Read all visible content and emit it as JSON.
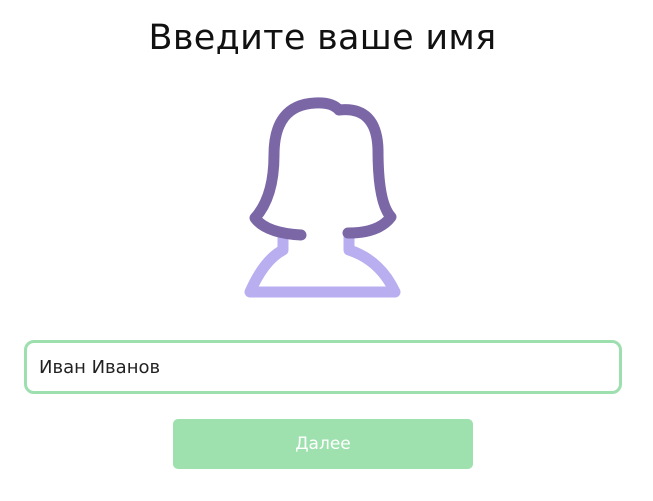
{
  "header": {
    "title": "Введите ваше имя"
  },
  "avatar": {
    "icon": "female-avatar-icon",
    "hair_color": "#7b67a6",
    "body_color": "#b9aef0"
  },
  "form": {
    "name_value": "Иван Иванов",
    "input_border_color": "#9ddfae"
  },
  "actions": {
    "next_label": "Далее",
    "next_color": "#9ee1ae"
  }
}
